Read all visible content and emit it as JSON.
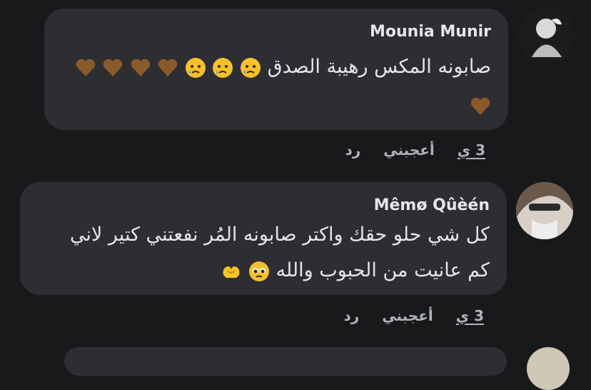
{
  "comments": [
    {
      "author": "Mounia Munir",
      "text_line1": "صابونه المكس رهيبة الصدق",
      "time": "3 ي",
      "like_label": "أعجبني",
      "reply_label": "رد"
    },
    {
      "author": "Mêmø Qûèén",
      "text_line1": "كل شي حلو حقك واكتر صابونه المُر نفعتني كتير لاني",
      "text_line2": "كم عانيت من الحبوب والله",
      "time": "3 ي",
      "like_label": "أعجبني",
      "reply_label": "رد"
    }
  ],
  "colors": {
    "background": "#18191a",
    "bubble": "#2d2e31",
    "text": "#e4e6eb",
    "secondary": "#b0b3b8",
    "heart": "#8b5a2b",
    "emoji": "#f6c12c",
    "tear": "#4aa3df"
  }
}
